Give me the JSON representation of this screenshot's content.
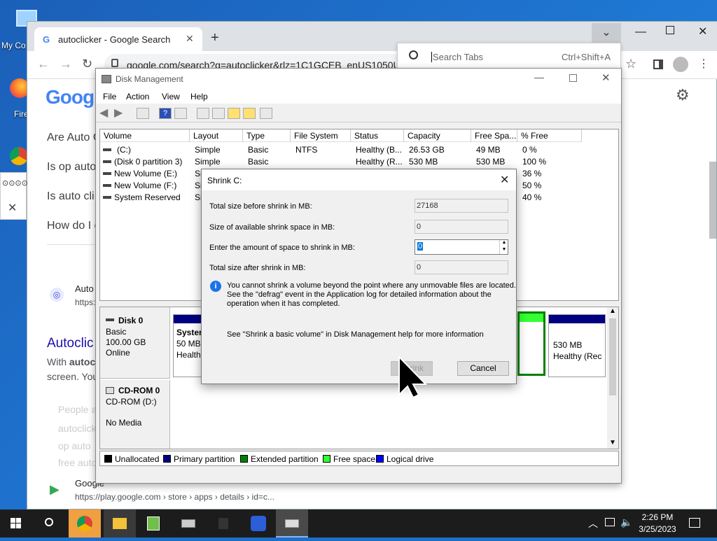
{
  "desktop": {
    "icons": [
      {
        "label": "My Co"
      },
      {
        "label": "Fire"
      }
    ]
  },
  "chrome": {
    "tab_title": "autoclicker - Google Search",
    "url": "google.com/search?q=autoclicker&rlz=1C1GCEB_enUS1050US",
    "search_tabs_placeholder": "Search Tabs",
    "search_tabs_shortcut": "Ctrl+Shift+A",
    "logo": "Goog",
    "questions": [
      "Are Auto C",
      "Is op auto",
      "Is auto cli",
      "How do I c"
    ],
    "result_site": "Auto",
    "result_url": "https:",
    "result_title": "Autoclic",
    "result_snippet_bold": "autocl",
    "result_snippet_pre": "With ",
    "result_snippet_2": "screen. You",
    "people_also": [
      "People a",
      "autoclick",
      "op auto",
      "free auto"
    ],
    "play_site": "Google",
    "play_url": "https://play.google.com › store › apps › details › id=c...",
    "sidebar_glyphs": "⊙⊙⊙⊙"
  },
  "dm": {
    "title": "Disk Management",
    "menus": [
      "File",
      "Action",
      "View",
      "Help"
    ],
    "columns": [
      "Volume",
      "Layout",
      "Type",
      "File System",
      "Status",
      "Capacity",
      "Free Spa...",
      "% Free"
    ],
    "rows": [
      [
        "(C:)",
        "Simple",
        "Basic",
        "NTFS",
        "Healthy (B...",
        "26.53 GB",
        "49 MB",
        "0 %"
      ],
      [
        "(Disk 0 partition 3)",
        "Simple",
        "Basic",
        "",
        "Healthy (R...",
        "530 MB",
        "530 MB",
        "100 %"
      ],
      [
        "New Volume (E:)",
        "Si",
        "",
        "",
        "",
        "",
        "",
        "36 %"
      ],
      [
        "New Volume (F:)",
        "Si",
        "",
        "",
        "",
        "",
        "",
        "50 %"
      ],
      [
        "System Reserved",
        "Si",
        "",
        "",
        "",
        "",
        "",
        "40 %"
      ]
    ],
    "disk0": {
      "name": "Disk 0",
      "type": "Basic",
      "size": "100.00 GB",
      "status": "Online"
    },
    "disk0_part1": {
      "name": "Syster",
      "size": "50 MB",
      "status": "Health"
    },
    "disk0_part_last": {
      "size": "530 MB",
      "status": "Healthy (Rec"
    },
    "cdrom": {
      "name": "CD-ROM 0",
      "drive": "CD-ROM (D:)",
      "media": "No Media"
    },
    "legend": [
      {
        "label": "Unallocated",
        "color": "#000000"
      },
      {
        "label": "Primary partition",
        "color": "#000080"
      },
      {
        "label": "Extended partition",
        "color": "#008000"
      },
      {
        "label": "Free space",
        "color": "#33ff33"
      },
      {
        "label": "Logical drive",
        "color": "#0000ff"
      }
    ]
  },
  "dialog": {
    "title": "Shrink C:",
    "total_before_label": "Total size before shrink in MB:",
    "total_before_value": "27168",
    "available_label": "Size of available shrink space in MB:",
    "available_value": "0",
    "enter_label": "Enter the amount of space to shrink in MB:",
    "enter_value": "0",
    "total_after_label": "Total size after shrink in MB:",
    "total_after_value": "0",
    "info_text_1": "You cannot shrink a volume beyond the point where any unmovable files are located.",
    "info_text_2": "See the \"defrag\" event in the Application log for detailed information about the",
    "info_text_3": "operation when it has completed.",
    "help_text": "See \"Shrink a basic volume\" in Disk Management help for more information",
    "shrink_button": "Shrink",
    "cancel_button": "Cancel"
  },
  "taskbar": {
    "time": "2:26 PM",
    "date": "3/25/2023"
  }
}
